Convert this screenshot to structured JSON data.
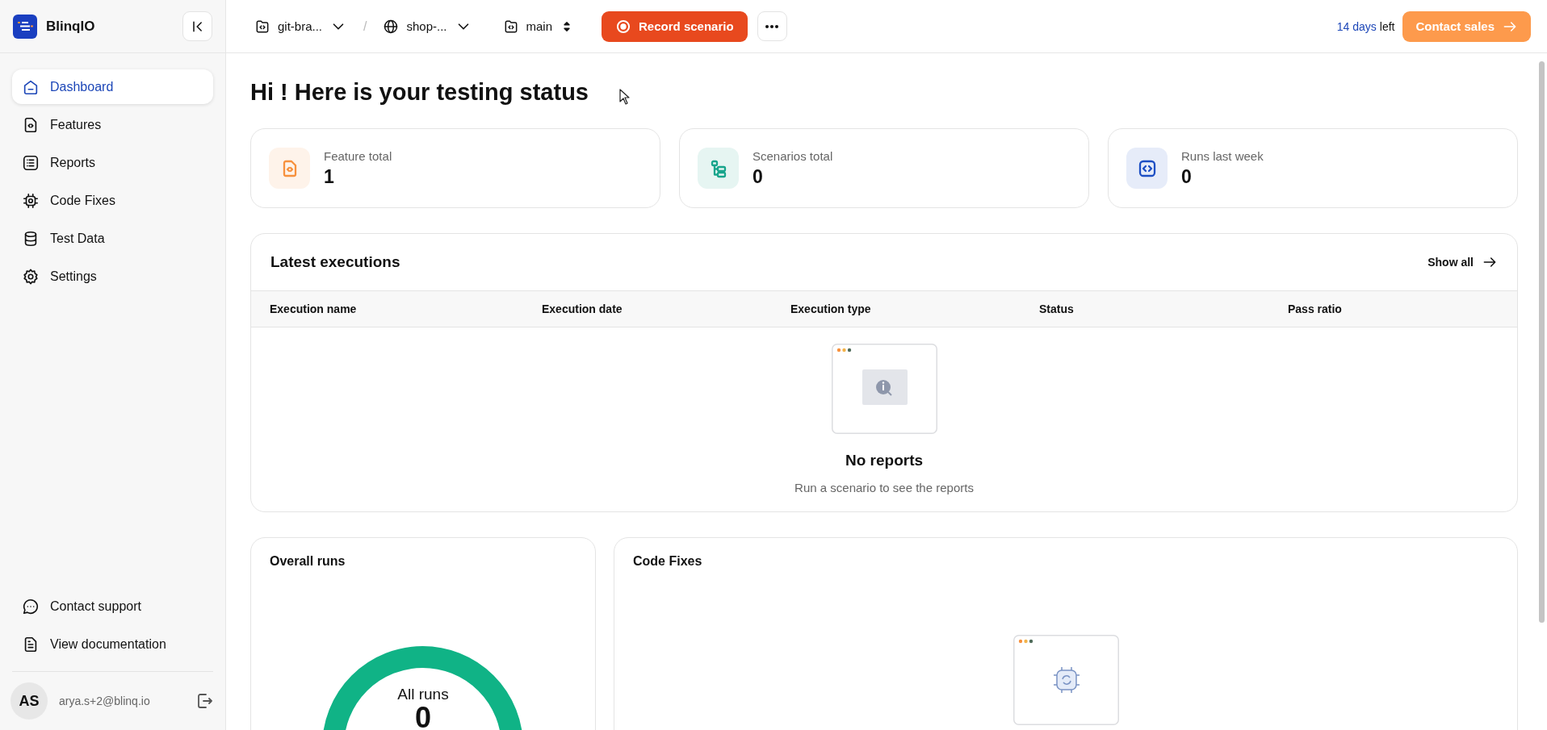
{
  "sidebar": {
    "brand": "BlinqIO",
    "items": [
      {
        "label": "Dashboard",
        "kind": "home",
        "selected": true
      },
      {
        "label": "Features",
        "kind": "file-code",
        "selected": false
      },
      {
        "label": "Reports",
        "kind": "list",
        "selected": false
      },
      {
        "label": "Code Fixes",
        "kind": "chip",
        "selected": false
      },
      {
        "label": "Test Data",
        "kind": "database",
        "selected": false
      },
      {
        "label": "Settings",
        "kind": "gear",
        "selected": false
      }
    ],
    "footer_items": [
      {
        "label": "Contact support",
        "kind": "chat"
      },
      {
        "label": "View documentation",
        "kind": "doc"
      }
    ],
    "user": {
      "initials": "AS",
      "email": "arya.s+2@blinq.io"
    }
  },
  "top_bar": {
    "breadcrumb": [
      {
        "label": "git-bra...",
        "kind": "folder-code"
      },
      {
        "label": "shop-...",
        "kind": "globe"
      }
    ],
    "separator": "/",
    "branch": {
      "label": "main",
      "kind": "folder-code"
    },
    "record_button": "Record scenario",
    "trial": {
      "highlight": "14 days",
      "text": "left"
    },
    "contact_button": "Contact sales"
  },
  "page_title": "Hi ! Here is your testing status",
  "stats": [
    {
      "label": "Feature total",
      "value": "1",
      "kind": "file-code",
      "color": "#f7913d"
    },
    {
      "label": "Scenarios total",
      "value": "0",
      "kind": "flow",
      "color": "#18a58c"
    },
    {
      "label": "Runs last week",
      "value": "0",
      "kind": "code-square",
      "color": "#1d4fc4"
    }
  ],
  "latest_executions": {
    "title": "Latest executions",
    "show_all": "Show all",
    "columns": [
      "Execution name",
      "Execution date",
      "Execution type",
      "Status",
      "Pass ratio"
    ],
    "empty_title": "No reports",
    "empty_message": "Run a scenario to see the reports"
  },
  "overall_runs": {
    "title": "Overall runs",
    "center_label": "All runs",
    "center_value": "0"
  },
  "code_fixes": {
    "title": "Code Fixes"
  }
}
